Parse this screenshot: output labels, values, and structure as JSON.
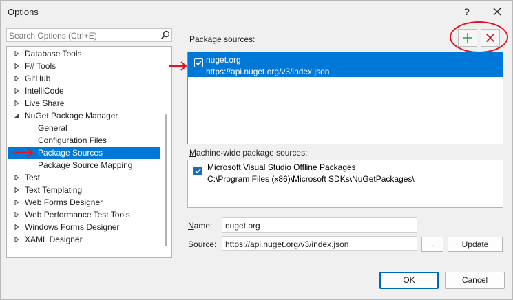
{
  "window": {
    "title": "Options",
    "help_label": "?"
  },
  "search": {
    "placeholder": "Search Options (Ctrl+E)"
  },
  "tree": {
    "items": [
      {
        "label": "Database Tools",
        "expandable": true,
        "level": 0
      },
      {
        "label": "F# Tools",
        "expandable": true,
        "level": 0
      },
      {
        "label": "GitHub",
        "expandable": true,
        "level": 0
      },
      {
        "label": "IntelliCode",
        "expandable": true,
        "level": 0
      },
      {
        "label": "Live Share",
        "expandable": true,
        "level": 0
      },
      {
        "label": "NuGet Package Manager",
        "expanded": true,
        "level": 0
      },
      {
        "label": "General",
        "level": 1
      },
      {
        "label": "Configuration Files",
        "level": 1
      },
      {
        "label": "Package Sources",
        "level": 1,
        "selected": true
      },
      {
        "label": "Package Source Mapping",
        "level": 1
      },
      {
        "label": "Test",
        "expandable": true,
        "level": 0
      },
      {
        "label": "Text Templating",
        "expandable": true,
        "level": 0
      },
      {
        "label": "Web Forms Designer",
        "expandable": true,
        "level": 0
      },
      {
        "label": "Web Performance Test Tools",
        "expandable": true,
        "level": 0
      },
      {
        "label": "Windows Forms Designer",
        "expandable": true,
        "level": 0
      },
      {
        "label": "XAML Designer",
        "expandable": true,
        "level": 0
      }
    ]
  },
  "package_sources": {
    "label": "Package sources:",
    "items": [
      {
        "name": "nuget.org",
        "url": "https://api.nuget.org/v3/index.json",
        "checked": true,
        "selected": true
      }
    ]
  },
  "machine_wide": {
    "label_accel": "M",
    "label_rest": "achine-wide package sources:",
    "items": [
      {
        "name": "Microsoft Visual Studio Offline Packages",
        "path": "C:\\Program Files (x86)\\Microsoft SDKs\\NuGetPackages\\",
        "checked": true
      }
    ]
  },
  "form": {
    "name_accel": "N",
    "name_rest": "ame:",
    "name_value": "nuget.org",
    "source_accel": "S",
    "source_rest": "ource:",
    "source_value": "https://api.nuget.org/v3/index.json",
    "browse_label": "...",
    "update_label": "Update"
  },
  "footer": {
    "ok_label": "OK",
    "cancel_label": "Cancel"
  },
  "colors": {
    "selection": "#0078d7",
    "add_icon": "#2e9b3f",
    "remove_icon": "#d0141f",
    "annotation": "#e4141e"
  }
}
